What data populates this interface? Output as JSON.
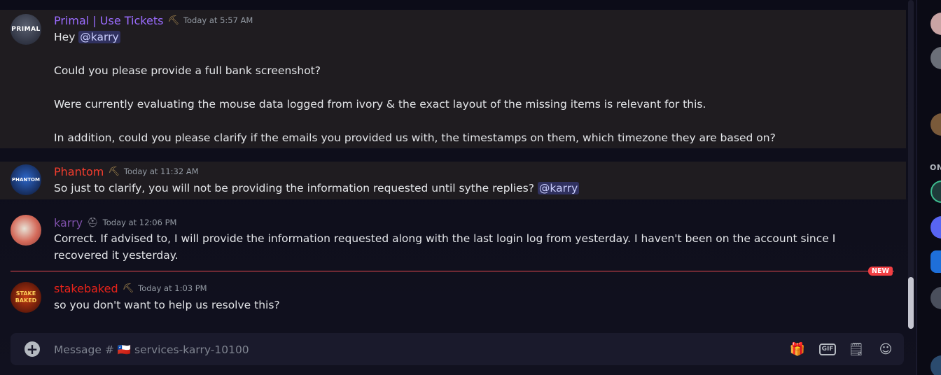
{
  "messages": [
    {
      "username": "Primal | Use Tickets",
      "name_color": "#9b6cff",
      "timestamp": "Today at 5:57 AM",
      "avatar_text": "PRIMAL",
      "lines": [
        {
          "text": "Hey ",
          "mention": "@karry"
        },
        {
          "text": "Could you please provide a full bank screenshot?"
        },
        {
          "text": "Were currently evaluating the mouse data logged from ivory & the exact layout of the missing items is relevant for this."
        },
        {
          "text": "In addition,  could you please clarify if the emails you provided us with, the timestamps on them, which timezone they are based on?"
        }
      ]
    },
    {
      "username": "Phantom",
      "name_color": "#f23d2e",
      "timestamp": "Today at 11:32 AM",
      "avatar_text": "PHANTOM",
      "text": "So just to clarify, you will not be providing the information requested until sythe replies? ",
      "mention": "@karry"
    },
    {
      "username": "karry",
      "name_color": "#7d4fa8",
      "timestamp": "Today at 12:06 PM",
      "text": "Correct. If advised to, I will provide the information requested along with the last login log from yesterday. I haven't been on the account since I recovered it yesterday."
    },
    {
      "username": "stakebaked",
      "name_color": "#e8231a",
      "timestamp": "Today at 1:03 PM",
      "avatar_text": "STAKE BAKED",
      "text": "so you don't want to  help us resolve this?"
    }
  ],
  "divider": {
    "label": "NEW"
  },
  "composer": {
    "placeholder": "Message # 🇨🇱 services-karry-10100",
    "gif_label": "GIF"
  },
  "rail": {
    "section_label": "ON"
  }
}
